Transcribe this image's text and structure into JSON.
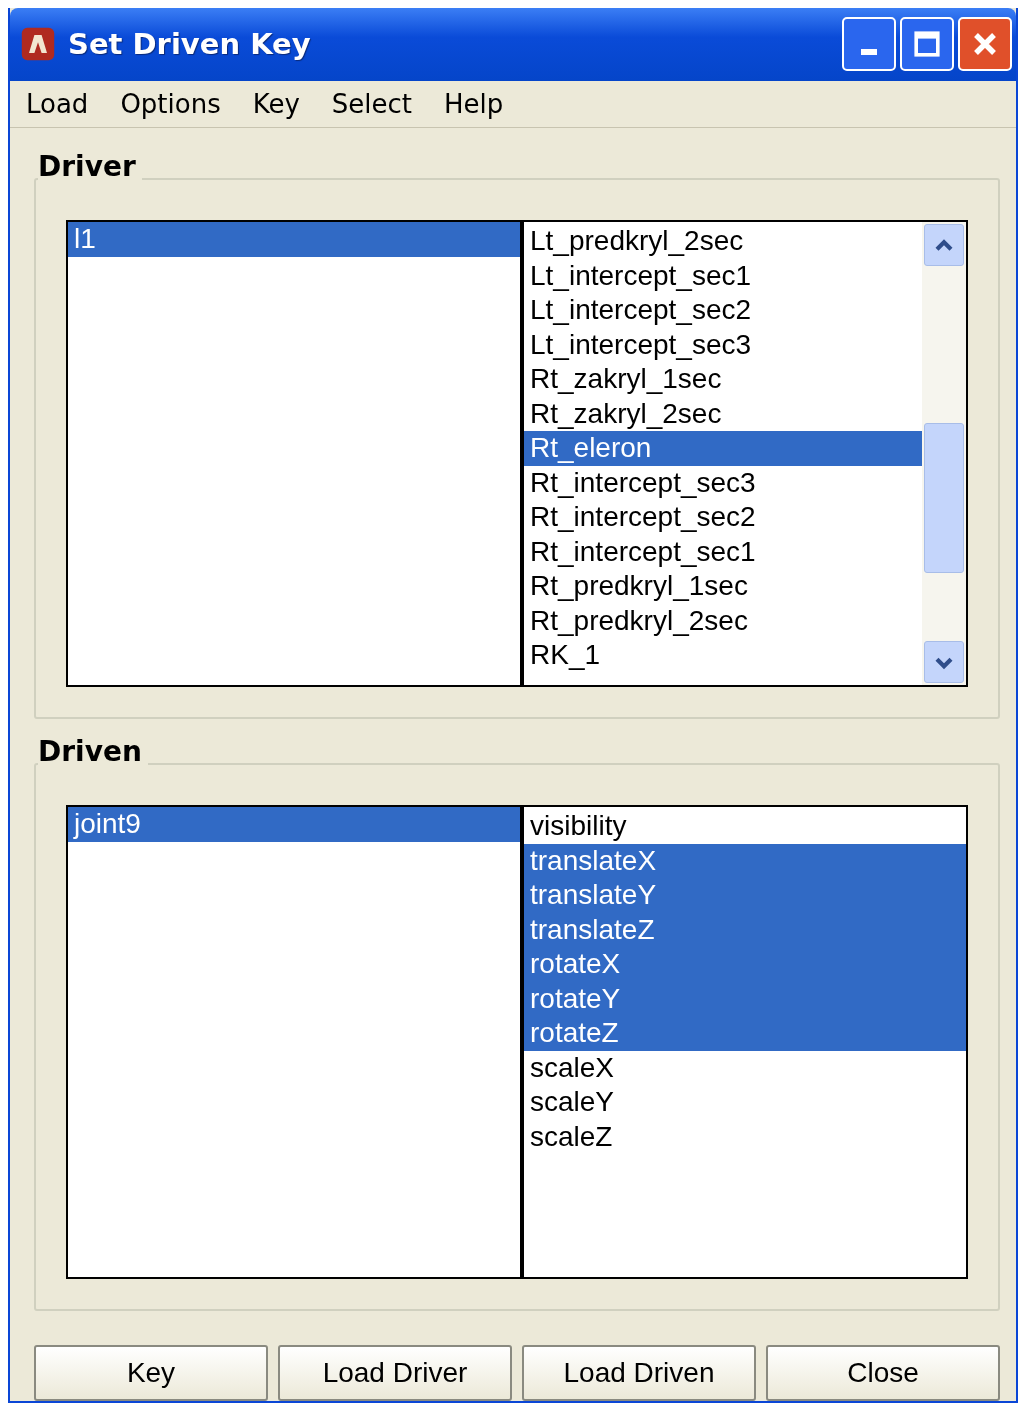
{
  "window": {
    "title": "Set Driven Key"
  },
  "menu": [
    "Load",
    "Options",
    "Key",
    "Select",
    "Help"
  ],
  "groups": [
    {
      "label": "Driver",
      "scrollbar": true,
      "objects": [
        {
          "label": "l1",
          "selected": true
        }
      ],
      "attributes": [
        {
          "label": "Lt_predkryl_2sec",
          "selected": false
        },
        {
          "label": "Lt_intercept_sec1",
          "selected": false
        },
        {
          "label": "Lt_intercept_sec2",
          "selected": false
        },
        {
          "label": "Lt_intercept_sec3",
          "selected": false
        },
        {
          "label": "Rt_zakryl_1sec",
          "selected": false
        },
        {
          "label": "Rt_zakryl_2sec",
          "selected": false
        },
        {
          "label": "Rt_eleron",
          "selected": true
        },
        {
          "label": "Rt_intercept_sec3",
          "selected": false
        },
        {
          "label": "Rt_intercept_sec2",
          "selected": false
        },
        {
          "label": "Rt_intercept_sec1",
          "selected": false
        },
        {
          "label": "Rt_predkryl_1sec",
          "selected": false
        },
        {
          "label": "Rt_predkryl_2sec",
          "selected": false
        },
        {
          "label": "RK_1",
          "selected": false
        }
      ]
    },
    {
      "label": "Driven",
      "scrollbar": false,
      "objects": [
        {
          "label": "joint9",
          "selected": true
        }
      ],
      "attributes": [
        {
          "label": "visibility",
          "selected": false
        },
        {
          "label": "translateX",
          "selected": true
        },
        {
          "label": "translateY",
          "selected": true
        },
        {
          "label": "translateZ",
          "selected": true
        },
        {
          "label": "rotateX",
          "selected": true
        },
        {
          "label": "rotateY",
          "selected": true
        },
        {
          "label": "rotateZ",
          "selected": true
        },
        {
          "label": "scaleX",
          "selected": false
        },
        {
          "label": "scaleY",
          "selected": false
        },
        {
          "label": "scaleZ",
          "selected": false
        }
      ]
    }
  ],
  "buttons": [
    "Key",
    "Load Driver",
    "Load Driven",
    "Close"
  ]
}
